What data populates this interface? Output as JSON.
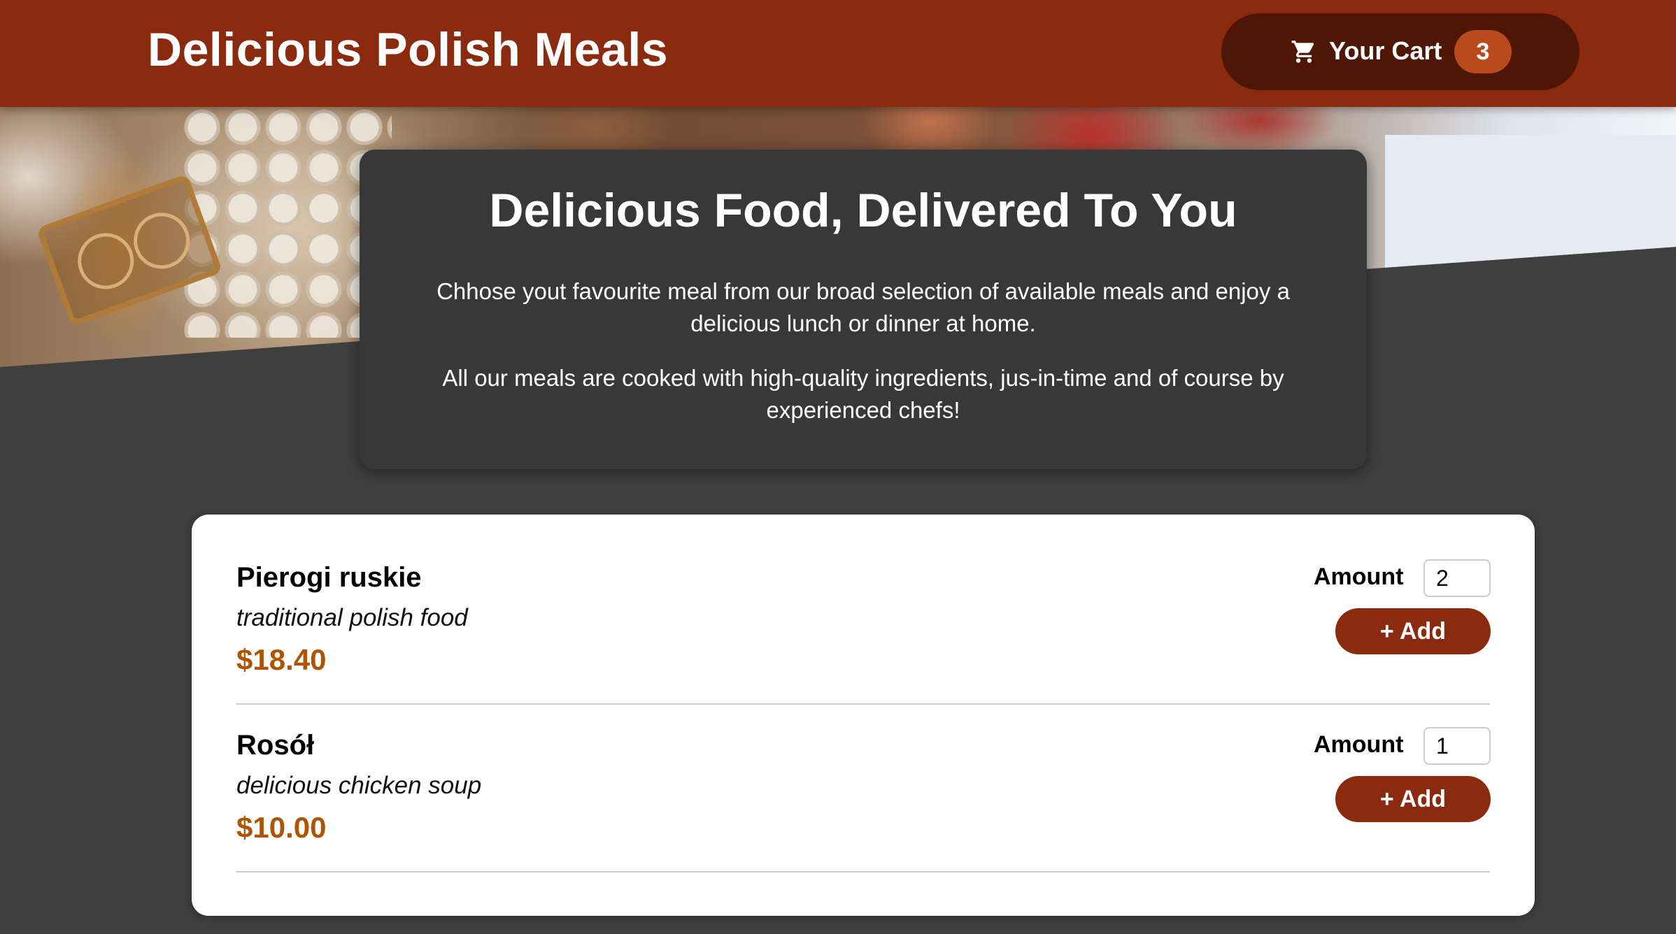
{
  "header": {
    "title": "Delicious Polish Meals",
    "cart": {
      "icon": "shopping-cart-icon",
      "label": "Your Cart",
      "count": "3"
    }
  },
  "hero": {
    "title": "Delicious Food, Delivered To You",
    "paragraph1": "Chhose yout favourite meal from our broad selection of available meals and enjoy a delicious lunch or dinner at home.",
    "paragraph2": "All our meals are cooked with high-quality ingredients, jus-in-time and of course by experienced chefs!"
  },
  "meals": [
    {
      "name": "Pierogi ruskie",
      "description": "traditional polish food",
      "price": "$18.40",
      "amount_label": "Amount",
      "amount": "2",
      "add_label": "+ Add"
    },
    {
      "name": "Rosół",
      "description": "delicious chicken soup",
      "price": "$10.00",
      "amount_label": "Amount",
      "amount": "1",
      "add_label": "+ Add"
    }
  ],
  "colors": {
    "header_bg": "#8a2b0f",
    "cart_button_bg": "#4d1605",
    "badge_bg": "#b94a1c",
    "page_bg": "#3f3f3f",
    "price": "#ad5502"
  }
}
